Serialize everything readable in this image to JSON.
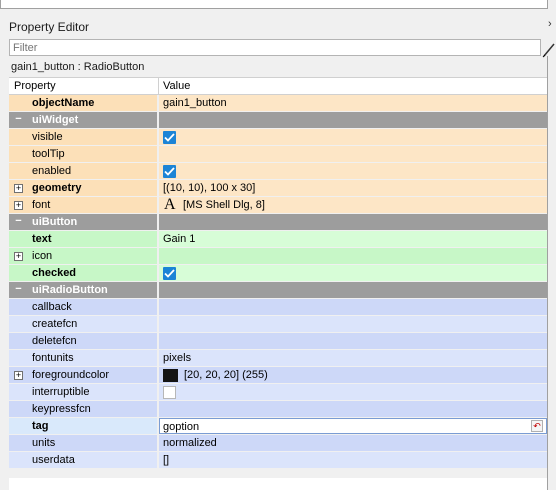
{
  "panel": {
    "title": "Property Editor",
    "title_arrow": "›",
    "filter_placeholder": "Filter",
    "object_caption": "gain1_button : RadioButton"
  },
  "table": {
    "col_property": "Property",
    "col_value": "Value"
  },
  "rows": {
    "objectName": {
      "label": "objectName",
      "value": "gain1_button"
    },
    "uiWidget": {
      "label": "uiWidget"
    },
    "visible": {
      "label": "visible",
      "checked": true
    },
    "toolTip": {
      "label": "toolTip",
      "value": ""
    },
    "enabled": {
      "label": "enabled",
      "checked": true
    },
    "geometry": {
      "label": "geometry",
      "value": "[(10, 10), 100 x 30]"
    },
    "font": {
      "label": "font",
      "glyph": "A",
      "value": "[MS Shell Dlg, 8]"
    },
    "uiButton": {
      "label": "uiButton"
    },
    "text": {
      "label": "text",
      "value": "Gain 1"
    },
    "icon": {
      "label": "icon",
      "value": ""
    },
    "checked": {
      "label": "checked",
      "checked": true
    },
    "uiRadioButton": {
      "label": "uiRadioButton"
    },
    "callback": {
      "label": "callback",
      "value": ""
    },
    "createfcn": {
      "label": "createfcn",
      "value": ""
    },
    "deletefcn": {
      "label": "deletefcn",
      "value": ""
    },
    "fontunits": {
      "label": "fontunits",
      "value": "pixels"
    },
    "foregroundcolor": {
      "label": "foregroundcolor",
      "value": "[20, 20, 20] (255)",
      "swatch": "#141414"
    },
    "interruptible": {
      "label": "interruptible",
      "checked": false
    },
    "keypressfcn": {
      "label": "keypressfcn",
      "value": ""
    },
    "tag": {
      "label": "tag",
      "value": "goption"
    },
    "units": {
      "label": "units",
      "value": "normalized"
    },
    "userdata": {
      "label": "userdata",
      "value": "[]"
    }
  },
  "colors": {
    "group_header": "#9d9d9d",
    "checkbox": "#1c84d6",
    "widget_rows": "#fde6c6",
    "button_rows": "#d7fdd7",
    "radio_rows": "#dbe4fb"
  }
}
